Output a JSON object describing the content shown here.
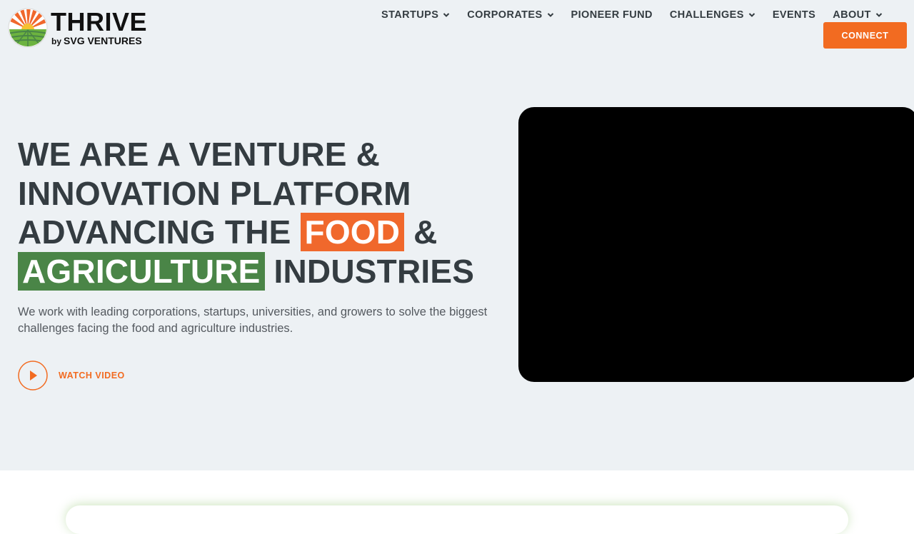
{
  "brand": {
    "name": "THRIVE",
    "by": "by",
    "subtitle": "SVG VENTURES"
  },
  "nav": {
    "items": [
      {
        "label": "STARTUPS",
        "dropdown": true
      },
      {
        "label": "CORPORATES",
        "dropdown": true
      },
      {
        "label": "PIONEER FUND",
        "dropdown": false
      },
      {
        "label": "CHALLENGES",
        "dropdown": true
      },
      {
        "label": "EVENTS",
        "dropdown": false
      },
      {
        "label": "ABOUT",
        "dropdown": true
      }
    ],
    "connect_label": "CONNECT"
  },
  "hero": {
    "line1": "WE ARE A VENTURE &",
    "line2": "INNOVATION PLATFORM",
    "line3_pre": "ADVANCING THE ",
    "line3_highlight": "FOOD",
    "line3_post": " &",
    "line4_highlight": "AGRICULTURE",
    "line4_post": " INDUSTRIES",
    "description": "We work with leading corporations, startups, universities, and growers to solve the biggest challenges facing the food and agriculture industries.",
    "watch_label": "WATCH VIDEO"
  },
  "colors": {
    "accent_orange": "#f26b21",
    "highlight_green": "#4a8547",
    "hero_bg": "#edf1f4",
    "text_dark": "#343c41"
  },
  "icons": {
    "dropdown": "chevron-down-icon",
    "play": "play-icon"
  }
}
